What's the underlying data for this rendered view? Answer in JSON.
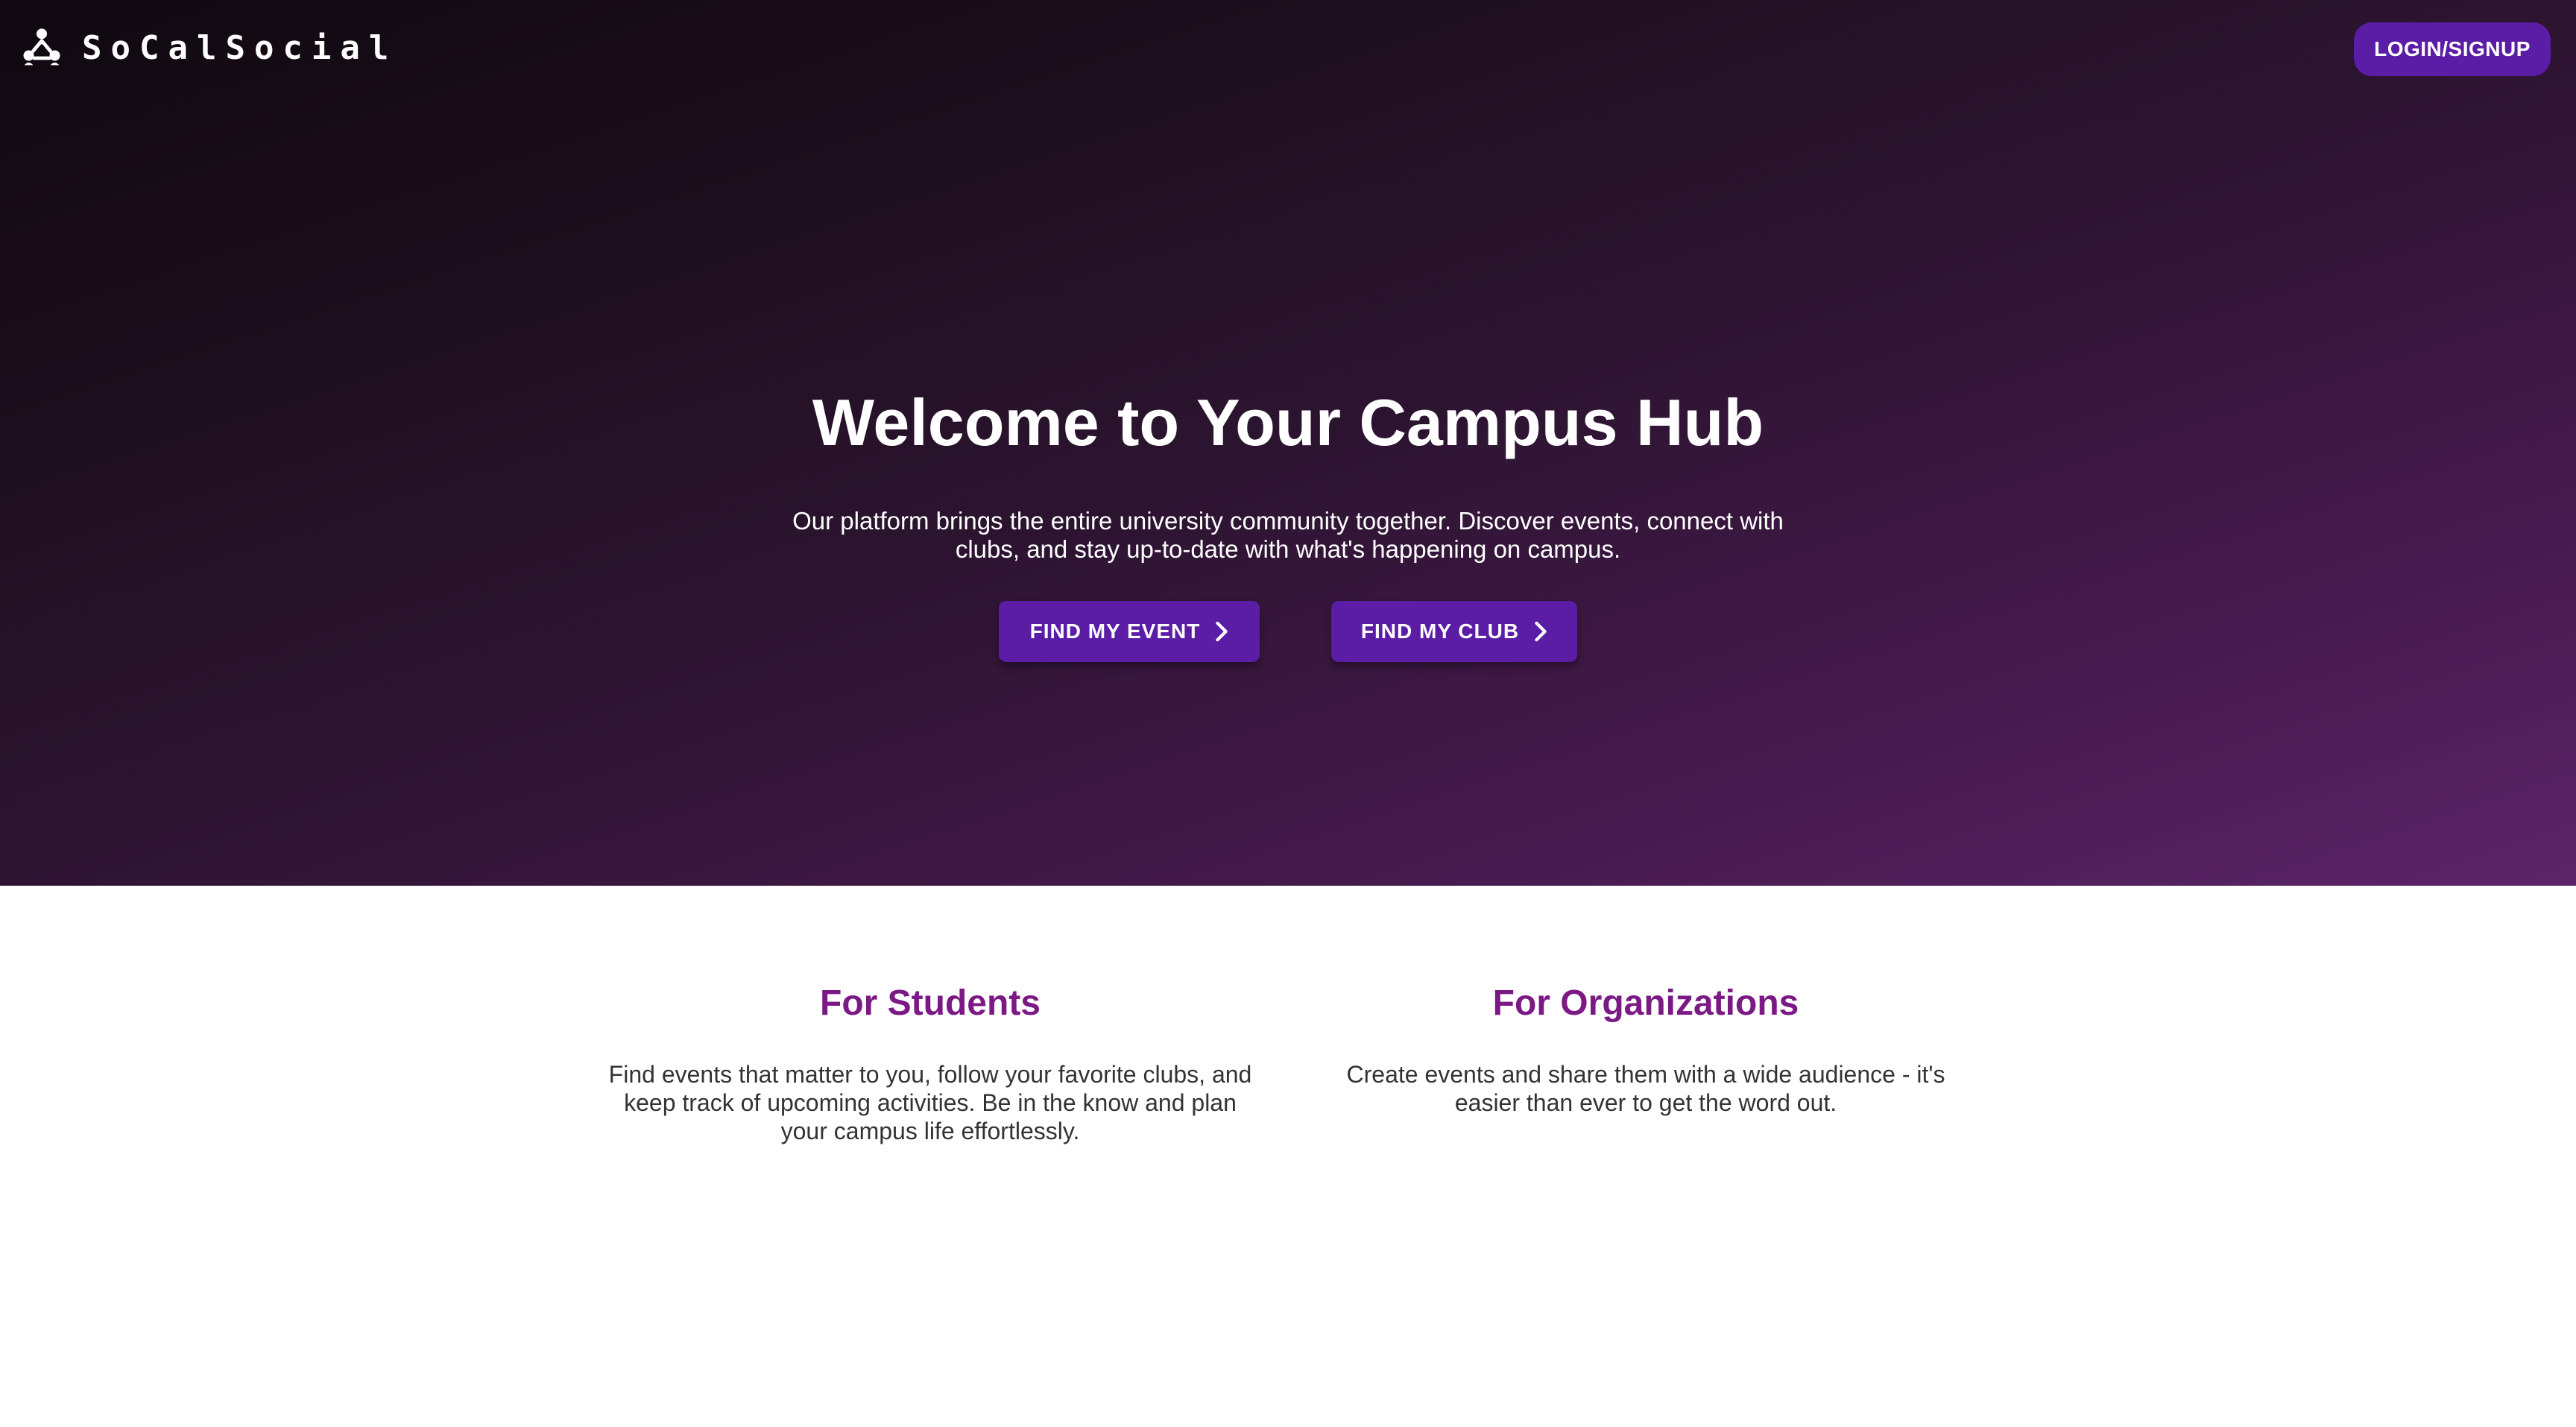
{
  "brand": {
    "name": "SoCalSocial",
    "icon": "triple-person-logo-icon"
  },
  "header": {
    "login_label": "LOGIN/SIGNUP"
  },
  "hero": {
    "title": "Welcome to Your Campus Hub",
    "description": "Our platform brings the entire university community together. Discover events, connect with clubs, and stay up-to-date with what's happening on campus.",
    "buttons": [
      {
        "label": "FIND MY EVENT",
        "icon": "chevron-right-icon"
      },
      {
        "label": "FIND MY CLUB",
        "icon": "chevron-right-icon"
      }
    ]
  },
  "features": [
    {
      "title": "For Students",
      "text": "Find events that matter to you, follow your favorite clubs, and keep track of upcoming activities. Be in the know and plan your campus life effortlessly."
    },
    {
      "title": "For Organizations",
      "text": "Create events and share them with a wide audience - it's easier than ever to get the word out."
    }
  ],
  "colors": {
    "accent_purple": "#5b1ca6",
    "heading_purple": "#7b1a85",
    "hero_dark": "#0f0810",
    "hero_light": "#5b2468"
  }
}
